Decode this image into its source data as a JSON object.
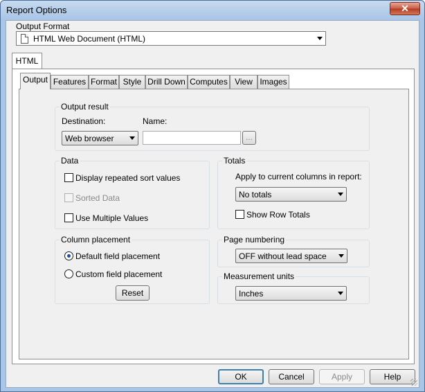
{
  "window": {
    "title": "Report Options",
    "close_glyph": "✕"
  },
  "output_format": {
    "label": "Output Format",
    "value": "HTML Web Document (HTML)",
    "icon": "document-icon"
  },
  "format_tab": {
    "label": "HTML"
  },
  "tabs": [
    {
      "label": "Output",
      "active": true
    },
    {
      "label": "Features"
    },
    {
      "label": "Format"
    },
    {
      "label": "Style"
    },
    {
      "label": "Drill Down"
    },
    {
      "label": "Computes"
    },
    {
      "label": "View"
    },
    {
      "label": "Images"
    }
  ],
  "output_result": {
    "title": "Output result",
    "destination_label": "Destination:",
    "destination_value": "Web browser",
    "name_label": "Name:",
    "name_value": "",
    "browse_label": "..."
  },
  "data_group": {
    "title": "Data",
    "display_repeated": "Display repeated sort values",
    "sorted_data": "Sorted Data",
    "use_multiple": "Use Multiple Values"
  },
  "totals_group": {
    "title": "Totals",
    "apply_label": "Apply to current columns in report:",
    "totals_value": "No totals",
    "show_row_totals": "Show Row Totals"
  },
  "column_placement": {
    "title": "Column placement",
    "default_option": "Default field placement",
    "custom_option": "Custom field placement",
    "reset_label": "Reset"
  },
  "page_numbering": {
    "title": "Page numbering",
    "value": "OFF without lead space"
  },
  "measurement_units": {
    "title": "Measurement units",
    "value": "Inches"
  },
  "buttons": {
    "ok": "OK",
    "cancel": "Cancel",
    "apply": "Apply",
    "help": "Help"
  }
}
